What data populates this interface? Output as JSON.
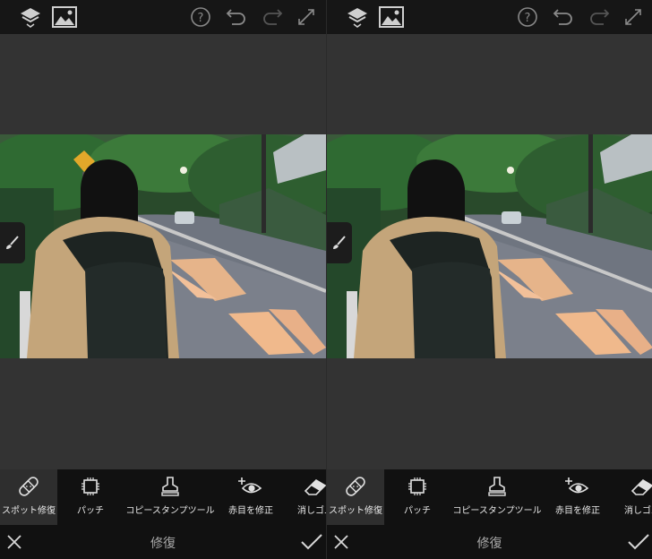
{
  "toolbar": {
    "tools": [
      {
        "label": "スポット修復",
        "icon": "spot-heal-bandage-icon"
      },
      {
        "label": "パッチ",
        "icon": "patch-chip-icon"
      },
      {
        "label": "コピースタンプツール",
        "icon": "clone-stamp-icon"
      },
      {
        "label": "赤目を修正",
        "icon": "red-eye-icon"
      },
      {
        "label": "消しゴム",
        "icon": "eraser-icon"
      }
    ]
  },
  "bottom": {
    "title": "修復",
    "cancel_icon": "close-icon",
    "apply_icon": "checkmark-icon"
  },
  "colors": {
    "topbar": "#161616",
    "canvas": "#333333",
    "toolbar": "#111111",
    "active_tool": "#2e2e2e"
  }
}
